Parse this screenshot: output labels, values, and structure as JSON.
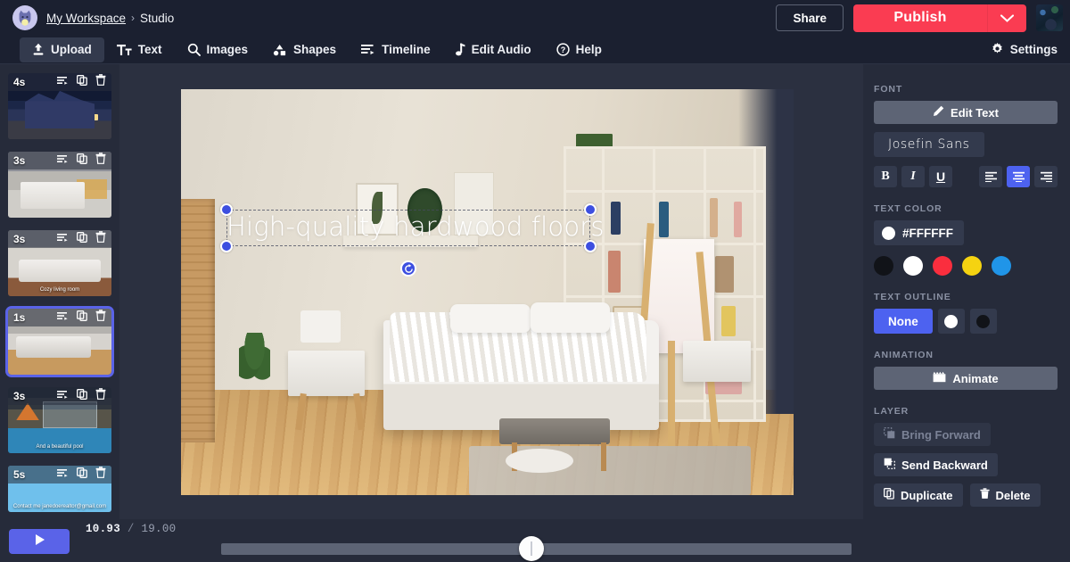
{
  "header": {
    "avatar_icon": "cat-avatar",
    "workspace": "My Workspace",
    "separator": "›",
    "current": "Studio",
    "share_label": "Share",
    "publish_label": "Publish",
    "publish_caret_icon": "chevron-down-icon",
    "profile_photo_icon": "user-profile-photo"
  },
  "toolbar": {
    "items": [
      {
        "label": "Upload",
        "icon": "upload-icon",
        "active": true
      },
      {
        "label": "Text",
        "icon": "text-icon",
        "active": false
      },
      {
        "label": "Images",
        "icon": "search-icon",
        "active": false
      },
      {
        "label": "Shapes",
        "icon": "shapes-icon",
        "active": false
      },
      {
        "label": "Timeline",
        "icon": "timeline-icon",
        "active": false
      },
      {
        "label": "Edit Audio",
        "icon": "music-note-icon",
        "active": false
      },
      {
        "label": "Help",
        "icon": "help-circle-icon",
        "active": false
      }
    ],
    "settings_label": "Settings",
    "settings_icon": "gear-icon"
  },
  "scenes": {
    "row_icons": [
      "caption-icon",
      "duplicate-icon",
      "trash-icon"
    ],
    "items": [
      {
        "duration": "4s",
        "caption": "",
        "selected": false,
        "art": "house"
      },
      {
        "duration": "3s",
        "caption": "",
        "selected": false,
        "art": "kitchen"
      },
      {
        "duration": "3s",
        "caption": "Cozy living room",
        "selected": false,
        "art": "living"
      },
      {
        "duration": "1s",
        "caption": "",
        "selected": true,
        "art": "bedroom"
      },
      {
        "duration": "3s",
        "caption": "And a beautiful pool",
        "selected": false,
        "art": "pool"
      },
      {
        "duration": "5s",
        "caption": "Contact me\njanedoerealtor@gmail.com",
        "selected": false,
        "art": "contact"
      }
    ]
  },
  "transport": {
    "play_icon": "play-icon",
    "current_time": "10.93",
    "separator": "/",
    "total_time": "19.00",
    "scrubber_icon": "scrubber-handle"
  },
  "canvas": {
    "text_object": {
      "value": "High-quality hardwood floors",
      "handles": [
        "top-left",
        "top-right",
        "bottom-left",
        "bottom-right"
      ],
      "rotate_icon": "rotate-icon"
    }
  },
  "right_panel": {
    "font_section_label": "FONT",
    "edit_text_label": "Edit Text",
    "edit_text_icon": "pencil-icon",
    "font_name": "Josefin Sans",
    "bold_label": "B",
    "italic_label": "I",
    "underline_label": "U",
    "align_icons": [
      "align-left-icon",
      "align-center-icon",
      "align-right-icon"
    ],
    "align_active": "align-center-icon",
    "text_color_label": "TEXT COLOR",
    "text_color_value": "#FFFFFF",
    "color_swatches": [
      "#111318",
      "#FFFFFF",
      "#FA2E3E",
      "#F5D311",
      "#2095E8"
    ],
    "text_outline_label": "TEXT OUTLINE",
    "outline_none_label": "None",
    "outline_options": [
      "#FFFFFF",
      "#111318"
    ],
    "animation_label": "ANIMATION",
    "animate_label": "Animate",
    "animate_icon": "clapperboard-icon",
    "layer_label": "LAYER",
    "bring_forward_label": "Bring Forward",
    "bring_forward_icon": "bring-forward-icon",
    "send_backward_label": "Send Backward",
    "send_backward_icon": "send-backward-icon",
    "duplicate_label": "Duplicate",
    "duplicate_icon": "duplicate-icon",
    "delete_label": "Delete",
    "delete_icon": "trash-icon"
  },
  "colors": {
    "accent_blue": "#4d62f0",
    "publish_red": "#fa3c52",
    "panel_bg": "#262b3a",
    "bar_bg": "#1b2030"
  }
}
